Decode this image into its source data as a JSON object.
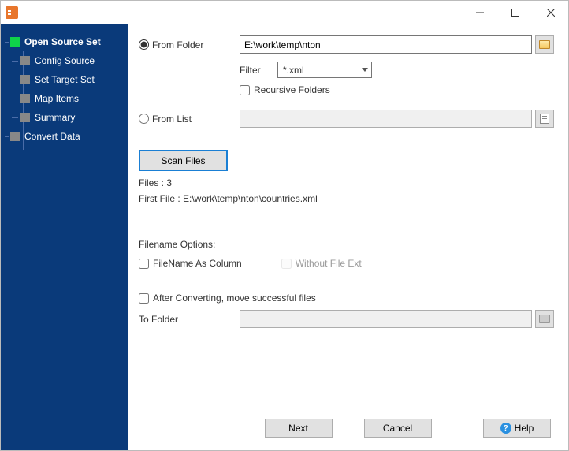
{
  "sidebar": {
    "items": [
      {
        "label": "Open Source Set",
        "active": true,
        "root": true
      },
      {
        "label": "Config Source"
      },
      {
        "label": "Set Target Set"
      },
      {
        "label": "Map Items"
      },
      {
        "label": "Summary"
      },
      {
        "label": "Convert Data",
        "root": true
      }
    ]
  },
  "form": {
    "from_folder_label": "From Folder",
    "from_folder_value": "E:\\work\\temp\\nton",
    "filter_label": "Filter",
    "filter_value": "*.xml",
    "recursive_label": "Recursive Folders",
    "from_list_label": "From List",
    "from_list_value": "",
    "scan_button": "Scan Files",
    "files_count_label": "Files : 3",
    "first_file_label": "First File : E:\\work\\temp\\nton\\countries.xml",
    "filename_options_header": "Filename Options:",
    "filename_as_column_label": "FileName As Column",
    "without_ext_label": "Without File Ext",
    "after_convert_label": "After Converting, move successful files",
    "to_folder_label": "To Folder",
    "to_folder_value": ""
  },
  "buttons": {
    "next": "Next",
    "cancel": "Cancel",
    "help": "Help"
  }
}
